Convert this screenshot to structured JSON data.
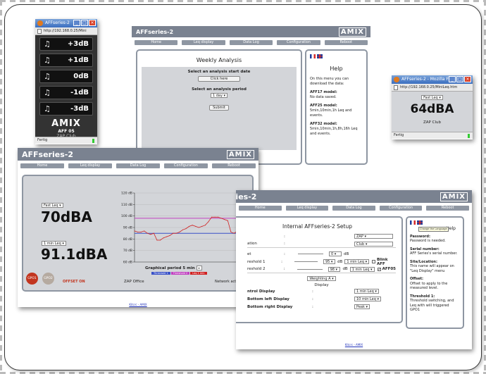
{
  "zap_window": {
    "title": "AFFseries-2",
    "url": "http://192.168.0.25/Mini",
    "buttons": [
      {
        "label": "+3dB"
      },
      {
        "label": "+1dB"
      },
      {
        "label": "0dB"
      },
      {
        "label": "-1dB"
      },
      {
        "label": "-3dB"
      }
    ],
    "logo": "AMIX",
    "model": "AFF 05",
    "venue": "ZAP Club",
    "status": "Fertig"
  },
  "weekly": {
    "brand": "AFFseries-2",
    "logo": "AMIX",
    "nav": [
      "Home",
      "Leq display",
      "Data Log",
      "Configuration",
      "Reboot"
    ],
    "title": "Weekly Analysis",
    "start_label": "Select an analysis start date",
    "start_link": "Click here",
    "period_label": "Select an analysis period",
    "period_value": "1 day",
    "submit": "Submit",
    "help_title": "Help",
    "help_intro": "On this menu you can download the data:",
    "help_aff17_title": "AFF17 model:",
    "help_aff17_text": "No data saved.",
    "help_aff25_title": "AFF25 model:",
    "help_aff25_text": "5min,10min,1h Leq and events.",
    "help_aff32_title": "AFF32 model:",
    "help_aff32_text": "5min,10min,1h,8h,16h Leq and events."
  },
  "fastleq_window": {
    "title": "AFFseries-2 - Mozilla Fir...",
    "url": "http://192.168.0.25/MiniLeq.htm",
    "select": "Fast Leq",
    "value": "64dBA",
    "venue": "ZAP Club",
    "status": "Fertig"
  },
  "leq_display": {
    "brand": "AFFseries-2",
    "logo": "AMIX",
    "nav": [
      "Home",
      "Leq display",
      "Data Log",
      "Configuration",
      "Reboot"
    ],
    "select_top": "Fast Leq",
    "value_top": "70dBA",
    "select_bottom": "1 min Leq",
    "value_bottom": "91.1dBA",
    "gpo1": "GPO1",
    "gpo2": "GPO2",
    "offset": "OFFSET ON",
    "venue": "ZAP Office",
    "network": "Network activity",
    "period_label": "Graphical period 5 min",
    "legend": [
      "Threshold 1",
      "Threshold 2",
      "Leq 1 min"
    ],
    "footer_link": "Kitcrc - AMIX"
  },
  "setup": {
    "brand": "AFFseries-2",
    "logo": "AMIX",
    "nav": [
      "Home",
      "Leq display",
      "Data Log",
      "Configuration",
      "Reboot"
    ],
    "title": "Internal AFFseries-2 Setup",
    "name_value": "ZAP",
    "location_label": "ation",
    "location_value": "Club",
    "offset_label": "et",
    "offset_value": "0",
    "threshold1_label": "reshold 1",
    "threshold1_value": "95",
    "threshold1_select": "1 min Leq",
    "blink_label": "Blink AFF",
    "threshold2_label": "reshold 2",
    "threshold2_value": "98",
    "threshold2_select": "1 min Leq",
    "aff05_label": "AFF05",
    "weighting": "Weighting A",
    "display_label": "Display",
    "control_label": "ntrol Display",
    "control_value": "1 min Leq",
    "bottom_left_label": "Bottom left Display",
    "bottom_left_value": "10 min Leq",
    "bottom_right_label": "Bottom right Display",
    "bottom_right_value": "Peak",
    "tooltip": "Change the Language",
    "help_title": "Help",
    "help_items": [
      {
        "title": "Password:",
        "text": "Password is needed."
      },
      {
        "title": "Serial number:",
        "text": "AFF Series's serial number."
      },
      {
        "title": "Site/Location:",
        "text": "This name will appear on \"Leq Display\" menu"
      },
      {
        "title": "Offset:",
        "text": "Offset to apply to the measured level."
      },
      {
        "title": "Threshold 1:",
        "text": "Threshold switching, and Leq with will triggered GPO1"
      }
    ],
    "footer_link": "Kitcrc - AMIX"
  },
  "chart_data": {
    "type": "line",
    "ylim": [
      60,
      120
    ],
    "yticks": [
      "120 dB",
      "110 dB",
      "100 dB",
      "90 dB",
      "80 dB",
      "70 dB",
      "60 dB"
    ],
    "series": [
      {
        "name": "Threshold 1",
        "color": "#3a52c8",
        "values": [
          85,
          85
        ]
      },
      {
        "name": "Threshold 2",
        "color": "#c040c0",
        "values": [
          98,
          98
        ]
      },
      {
        "name": "Leq 1 min",
        "color": "#d02020",
        "values": [
          87,
          86,
          86,
          87,
          85,
          84,
          85,
          79,
          79,
          81,
          82,
          83,
          85,
          85,
          86,
          88,
          89,
          91,
          92,
          91,
          90,
          91,
          92,
          95,
          99,
          99,
          99,
          98,
          97,
          96,
          86,
          85,
          87
        ]
      }
    ]
  }
}
